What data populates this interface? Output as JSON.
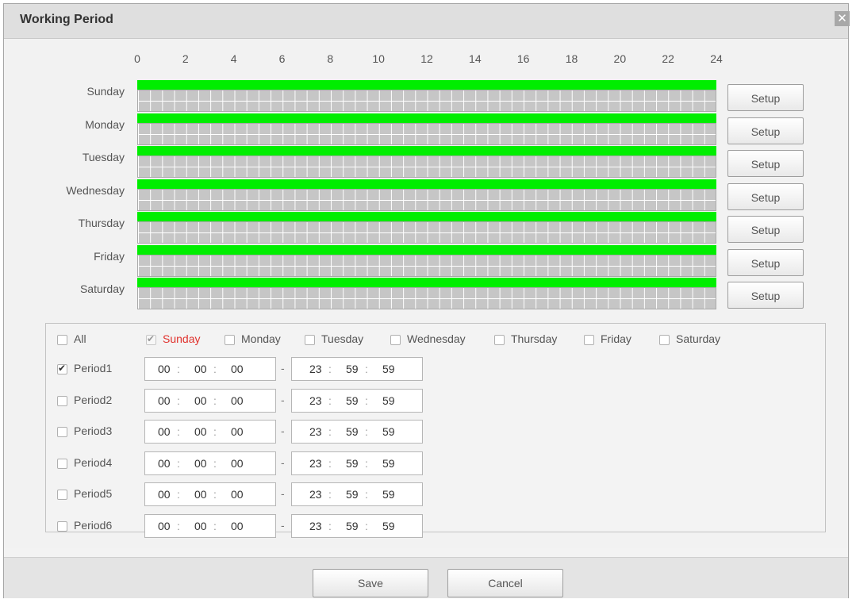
{
  "title": "Working Period",
  "close_icon": "close-icon",
  "hours": [
    "0",
    "2",
    "4",
    "6",
    "8",
    "10",
    "12",
    "14",
    "16",
    "18",
    "20",
    "22",
    "24"
  ],
  "days": [
    {
      "name": "Sunday",
      "setup": "Setup",
      "green_from": 0,
      "green_to": 24
    },
    {
      "name": "Monday",
      "setup": "Setup",
      "green_from": 0,
      "green_to": 24
    },
    {
      "name": "Tuesday",
      "setup": "Setup",
      "green_from": 0,
      "green_to": 24
    },
    {
      "name": "Wednesday",
      "setup": "Setup",
      "green_from": 0,
      "green_to": 24
    },
    {
      "name": "Thursday",
      "setup": "Setup",
      "green_from": 0,
      "green_to": 24
    },
    {
      "name": "Friday",
      "setup": "Setup",
      "green_from": 0,
      "green_to": 24
    },
    {
      "name": "Saturday",
      "setup": "Setup",
      "green_from": 0,
      "green_to": 24
    }
  ],
  "day_select": {
    "all": {
      "label": "All",
      "checked": false
    },
    "items": [
      {
        "label": "Sunday",
        "checked": true,
        "disabled": true,
        "highlight": true
      },
      {
        "label": "Monday",
        "checked": false
      },
      {
        "label": "Tuesday",
        "checked": false
      },
      {
        "label": "Wednesday",
        "checked": false
      },
      {
        "label": "Thursday",
        "checked": false
      },
      {
        "label": "Friday",
        "checked": false
      },
      {
        "label": "Saturday",
        "checked": false
      }
    ]
  },
  "periods": [
    {
      "label": "Period1",
      "checked": true,
      "start": [
        "00",
        "00",
        "00"
      ],
      "end": [
        "23",
        "59",
        "59"
      ]
    },
    {
      "label": "Period2",
      "checked": false,
      "start": [
        "00",
        "00",
        "00"
      ],
      "end": [
        "23",
        "59",
        "59"
      ]
    },
    {
      "label": "Period3",
      "checked": false,
      "start": [
        "00",
        "00",
        "00"
      ],
      "end": [
        "23",
        "59",
        "59"
      ]
    },
    {
      "label": "Period4",
      "checked": false,
      "start": [
        "00",
        "00",
        "00"
      ],
      "end": [
        "23",
        "59",
        "59"
      ]
    },
    {
      "label": "Period5",
      "checked": false,
      "start": [
        "00",
        "00",
        "00"
      ],
      "end": [
        "23",
        "59",
        "59"
      ]
    },
    {
      "label": "Period6",
      "checked": false,
      "start": [
        "00",
        "00",
        "00"
      ],
      "end": [
        "23",
        "59",
        "59"
      ]
    }
  ],
  "time_separator": ":",
  "range_dash": "-",
  "footer": {
    "save_label": "Save",
    "cancel_label": "Cancel"
  },
  "colors": {
    "active": "#00ee00",
    "highlight": "#e0322d"
  }
}
